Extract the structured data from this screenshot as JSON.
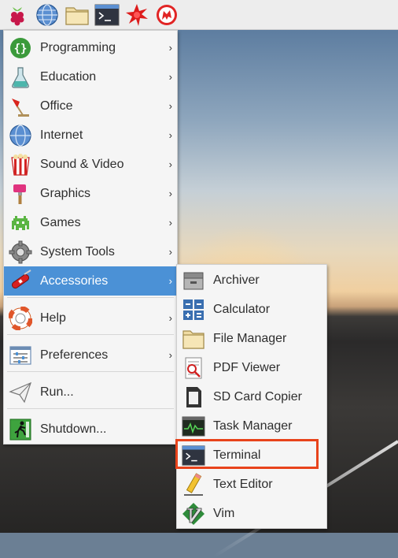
{
  "taskbar": {
    "buttons": [
      {
        "icon": "raspberry-pi-menu-icon"
      },
      {
        "icon": "web-browser-icon"
      },
      {
        "icon": "file-manager-icon"
      },
      {
        "icon": "terminal-icon"
      },
      {
        "icon": "mathematica-icon"
      },
      {
        "icon": "wolfram-icon"
      }
    ]
  },
  "main_menu": {
    "items": [
      {
        "label": "Programming",
        "icon": "programming-icon",
        "has_submenu": true
      },
      {
        "label": "Education",
        "icon": "education-icon",
        "has_submenu": true
      },
      {
        "label": "Office",
        "icon": "office-icon",
        "has_submenu": true
      },
      {
        "label": "Internet",
        "icon": "internet-icon",
        "has_submenu": true
      },
      {
        "label": "Sound & Video",
        "icon": "sound-video-icon",
        "has_submenu": true
      },
      {
        "label": "Graphics",
        "icon": "graphics-icon",
        "has_submenu": true
      },
      {
        "label": "Games",
        "icon": "games-icon",
        "has_submenu": true
      },
      {
        "label": "System Tools",
        "icon": "system-tools-icon",
        "has_submenu": true
      },
      {
        "label": "Accessories",
        "icon": "accessories-icon",
        "has_submenu": true,
        "active": true
      },
      {
        "label": "Help",
        "icon": "help-icon",
        "has_submenu": true
      },
      {
        "label": "Preferences",
        "icon": "preferences-icon",
        "has_submenu": true
      },
      {
        "label": "Run...",
        "icon": "run-icon",
        "has_submenu": false
      },
      {
        "label": "Shutdown...",
        "icon": "shutdown-icon",
        "has_submenu": false
      }
    ],
    "arrow": "›"
  },
  "accessories_menu": {
    "items": [
      {
        "label": "Archiver",
        "icon": "archiver-icon"
      },
      {
        "label": "Calculator",
        "icon": "calculator-icon"
      },
      {
        "label": "File Manager",
        "icon": "file-manager-icon"
      },
      {
        "label": "PDF Viewer",
        "icon": "pdf-viewer-icon"
      },
      {
        "label": "SD Card Copier",
        "icon": "sd-card-copier-icon"
      },
      {
        "label": "Task Manager",
        "icon": "task-manager-icon"
      },
      {
        "label": "Terminal",
        "icon": "terminal-icon",
        "highlighted": true
      },
      {
        "label": "Text Editor",
        "icon": "text-editor-icon"
      },
      {
        "label": "Vim",
        "icon": "vim-icon"
      }
    ]
  },
  "colors": {
    "active_item": "#4b91d6",
    "highlight_border": "#e8431b",
    "menu_bg": "#f5f5f5"
  }
}
